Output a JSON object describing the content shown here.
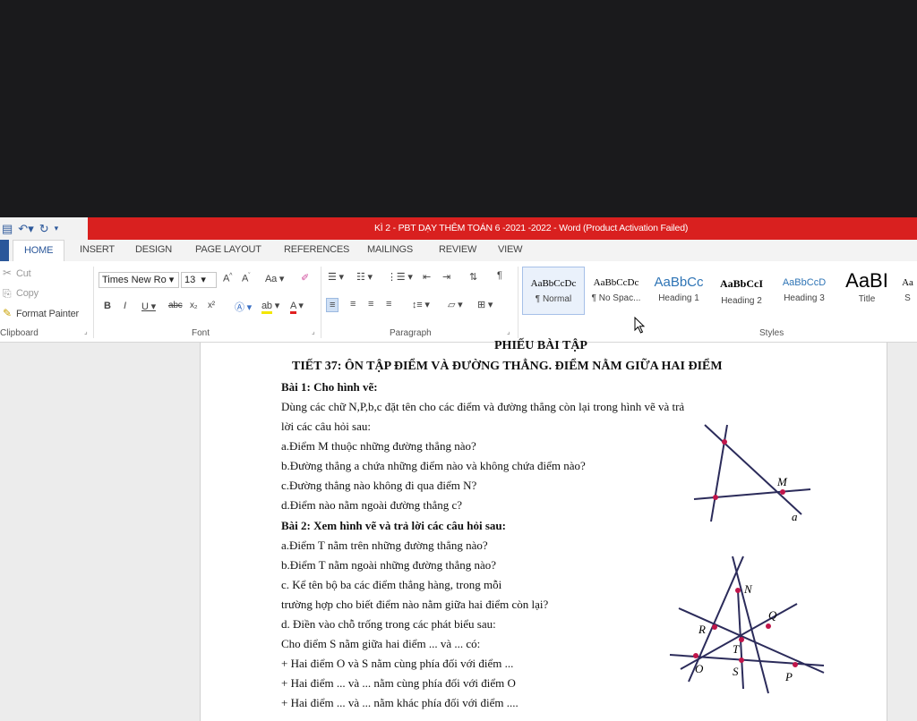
{
  "window": {
    "title": "KÌ 2 - PBT DẠY THÊM TOÁN 6 -2021 -2022 -  Word (Product Activation Failed)"
  },
  "tabs": [
    "HOME",
    "INSERT",
    "DESIGN",
    "PAGE LAYOUT",
    "REFERENCES",
    "MAILINGS",
    "REVIEW",
    "VIEW"
  ],
  "clipboard": {
    "cut": "Cut",
    "copy": "Copy",
    "format_painter": "Format Painter",
    "label": "Clipboard"
  },
  "font": {
    "name": "Times New Ro",
    "size": "13",
    "label": "Font"
  },
  "paragraph": {
    "label": "Paragraph"
  },
  "styles": {
    "label": "Styles",
    "items": [
      {
        "sample": "AaBbCcDc",
        "name": "¶ Normal"
      },
      {
        "sample": "AaBbCcDc",
        "name": "¶ No Spac..."
      },
      {
        "sample": "AaBbCc",
        "name": "Heading 1"
      },
      {
        "sample": "AaBbCcI",
        "name": "Heading 2"
      },
      {
        "sample": "AaBbCcD",
        "name": "Heading 3"
      },
      {
        "sample": "AaBI",
        "name": "Title"
      },
      {
        "sample": "Aa",
        "name": "S"
      }
    ]
  },
  "doc": {
    "lines": [
      "PHIẾU BÀI TẬP",
      "TIẾT 37: ÔN TẬP  ĐIỂM VÀ ĐƯỜNG THẲNG. ĐIỂM NẰM GIỮA HAI ĐIỂM",
      "Bài 1: Cho hình vẽ:",
      "Dùng các chữ N,P,b,c đặt tên cho các điểm và đường thẳng còn lại trong hình vẽ và trả",
      "lời các câu hỏi sau:",
      "a.Điểm M thuộc những đường thẳng nào?",
      "b.Đường thẳng a chứa những điểm nào và không chứa điểm nào?",
      "c.Đường thẳng nào không đi qua điểm N?",
      "d.Điểm nào nằm ngoài đường thẳng c?",
      "Bài 2: Xem hình vẽ và trả lời các câu hỏi sau:",
      "a.Điểm T nằm trên những đường thẳng nào?",
      "b.Điểm T nằm ngoài những đường thẳng nào?",
      "c. Kể tên bộ ba các điểm thẳng hàng, trong mỗi",
      "trường hợp cho biết điểm nào nằm giữa hai điểm còn lại?",
      "d. Điền vào chỗ trống trong các phát biểu sau:",
      "Cho  điểm S nằm giữa hai điểm ... và ... có:",
      "+ Hai điểm O và S nằm cùng phía đối với điểm ...",
      "+ Hai điểm ... và ... nằm cùng phía đối với điểm O",
      "+ Hai điểm ... và ... nằm khác phía đối với điểm ...."
    ],
    "fig1": {
      "M": "M",
      "a": "a"
    },
    "fig2": {
      "N": "N",
      "Q": "Q",
      "R": "R",
      "T": "T",
      "O": "O",
      "S": "S",
      "P": "P"
    }
  }
}
